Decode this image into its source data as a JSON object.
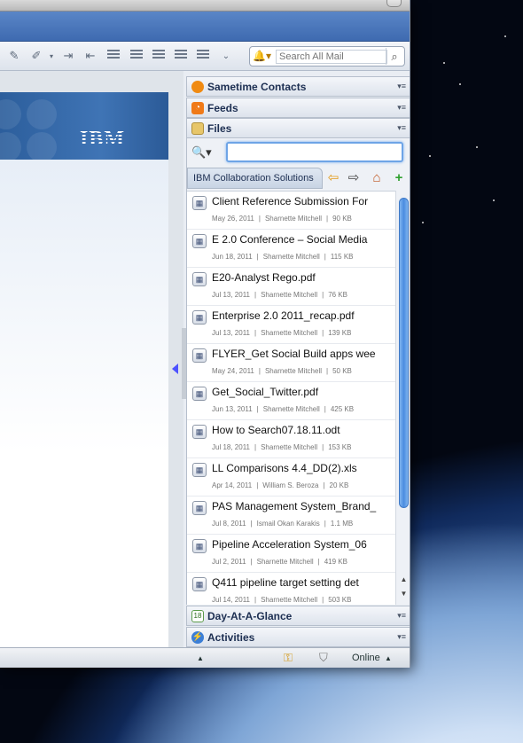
{
  "toolbar": {
    "icons": [
      "pen-icon",
      "highlighter-icon",
      "indent-icon",
      "outdent-icon",
      "bullet-list-icon",
      "numbered-list-icon",
      "align-center-icon",
      "align-justify-icon",
      "align-left-icon",
      "more-icon"
    ],
    "search_placeholder": "Search All Mail"
  },
  "document": {
    "banner_logo": "IBM"
  },
  "sidebar": {
    "panels": {
      "sametime": "Sametime Contacts",
      "feeds": "Feeds",
      "files": "Files",
      "day": "Day-At-A-Glance",
      "activities": "Activities"
    },
    "files": {
      "library": "IBM Collaboration Solutions",
      "search_value": "",
      "items": [
        {
          "name": "Client Reference Submission For",
          "date": "May 26, 2011",
          "author": "Sharnette Mitchell",
          "size": "90 KB"
        },
        {
          "name": "E 2.0 Conference – Social Media",
          "date": "Jun 18, 2011",
          "author": "Sharnette Mitchell",
          "size": "115 KB"
        },
        {
          "name": "E20-Analyst Rego.pdf",
          "date": "Jul 13, 2011",
          "author": "Sharnette Mitchell",
          "size": "76 KB"
        },
        {
          "name": "Enterprise 2.0 2011_recap.pdf",
          "date": "Jul 13, 2011",
          "author": "Sharnette Mitchell",
          "size": "139 KB"
        },
        {
          "name": "FLYER_Get Social Build apps wee",
          "date": "May 24, 2011",
          "author": "Sharnette Mitchell",
          "size": "50 KB"
        },
        {
          "name": "Get_Social_Twitter.pdf",
          "date": "Jun 13, 2011",
          "author": "Sharnette Mitchell",
          "size": "425 KB"
        },
        {
          "name": "How to Search07.18.11.odt",
          "date": "Jul 18, 2011",
          "author": "Sharnette Mitchell",
          "size": "153 KB"
        },
        {
          "name": "LL Comparisons 4.4_DD(2).xls",
          "date": "Apr 14, 2011",
          "author": "William S. Beroza",
          "size": "20 KB"
        },
        {
          "name": "PAS Management System_Brand_",
          "date": "Jul 8, 2011",
          "author": "Ismail Okan Karakis",
          "size": "1.1 MB"
        },
        {
          "name": "Pipeline Acceleration System_06",
          "date": "Jul 2, 2011",
          "author": "Sharnette Mitchell",
          "size": "419 KB"
        },
        {
          "name": "Q411 pipeline target setting det",
          "date": "Jul 14, 2011",
          "author": "Sharnette Mitchell",
          "size": "503 KB"
        }
      ]
    }
  },
  "statusbar": {
    "status": "Online"
  },
  "colors": {
    "accent_blue": "#3e6ab0",
    "scroll_thumb": "#4a8ce0",
    "add_green": "#2ea02e"
  }
}
